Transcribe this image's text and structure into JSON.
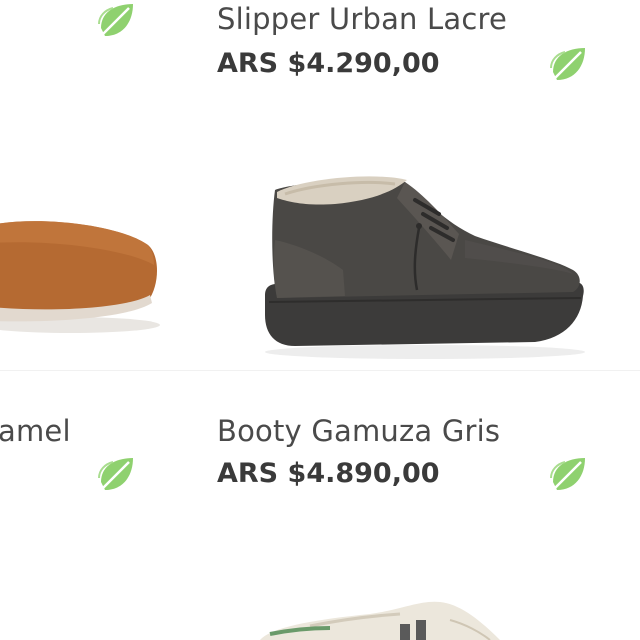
{
  "products": [
    {
      "name": "Slipper Urban Lacre",
      "price": "ARS $4.290,00",
      "eco_icon": "leaf-icon"
    },
    {
      "name": "amel",
      "price": "",
      "eco_icon": "leaf-icon"
    },
    {
      "name": "Booty Gamuza Gris",
      "price": "ARS $4.890,00",
      "eco_icon": "leaf-icon"
    }
  ],
  "colors": {
    "leaf": "#8fd16f",
    "leaf_dark": "#74bf55",
    "price_text": "#3a3a3a",
    "name_text": "#4a4a4a",
    "camel_shoe": "#b56a32",
    "grey_shoe": "#4a4845"
  }
}
